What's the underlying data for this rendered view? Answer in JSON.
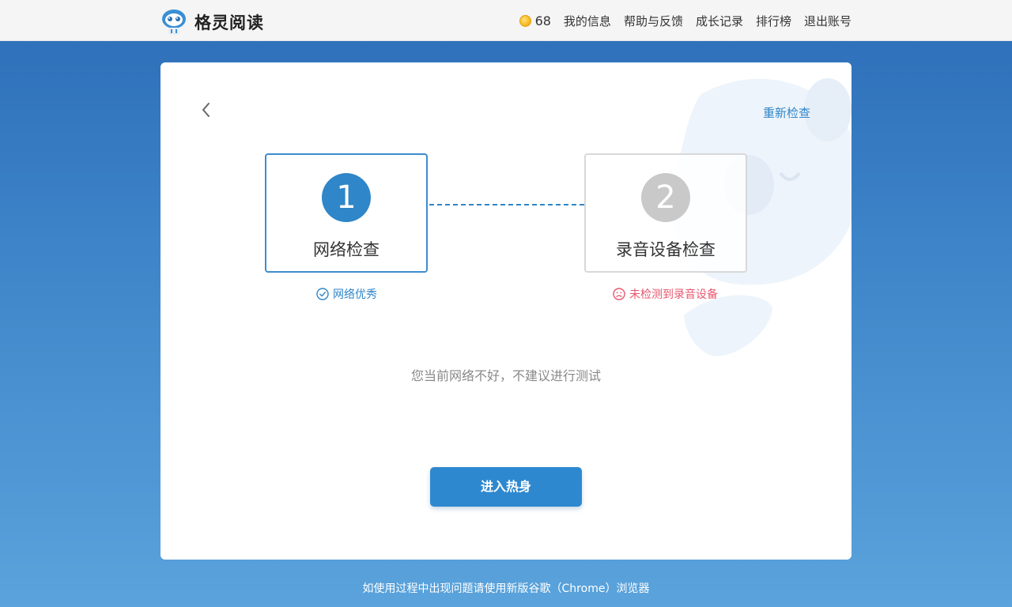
{
  "header": {
    "brand": "格灵阅读",
    "coins": "68",
    "nav": [
      "我的信息",
      "帮助与反馈",
      "成长记录",
      "排行榜",
      "退出账号"
    ]
  },
  "card": {
    "recheck_label": "重新检查",
    "steps": [
      {
        "number": "1",
        "label": "网络检查",
        "status": "网络优秀",
        "state": "ok"
      },
      {
        "number": "2",
        "label": "录音设备检查",
        "status": "未检测到录音设备",
        "state": "error"
      }
    ],
    "hint": "您当前网络不好，不建议进行测试",
    "enter_label": "进入热身"
  },
  "footer": "如使用过程中出现问题请使用新版谷歌（Chrome）浏览器",
  "colors": {
    "accent": "#2f86c8",
    "error": "#e8566e",
    "inactive": "#c9c9c9"
  },
  "icons": [
    "robot-logo-icon",
    "coin-icon",
    "chevron-left-icon",
    "check-circle-icon",
    "sad-face-icon"
  ]
}
